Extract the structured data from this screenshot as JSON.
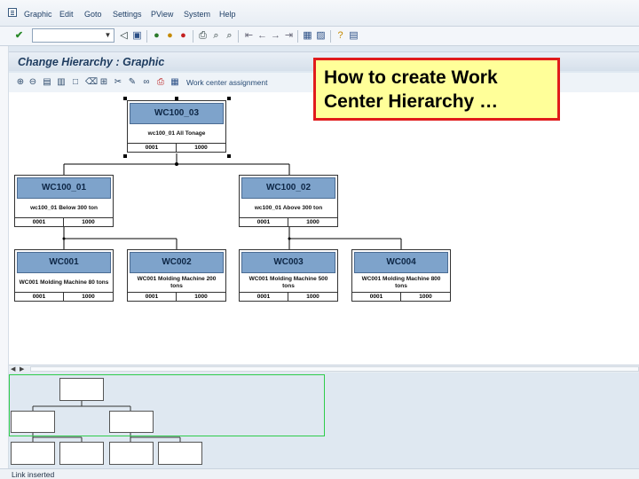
{
  "menu": {
    "items": [
      {
        "label": "Graphic"
      },
      {
        "label": "Edit"
      },
      {
        "label": "Goto"
      },
      {
        "label": "Settings"
      },
      {
        "label": "PView"
      },
      {
        "label": "System"
      },
      {
        "label": "Help"
      }
    ]
  },
  "toolbar": {
    "command_field_value": "",
    "icons": [
      "enter-icon",
      "save-icon",
      "back-icon",
      "exit-icon",
      "cancel-icon",
      "print-icon",
      "find-icon",
      "find-next-icon",
      "first-page-icon",
      "previous-page-icon",
      "next-page-icon",
      "last-page-icon",
      "create-session-icon",
      "shortcut-icon",
      "help-icon",
      "layout-icon"
    ]
  },
  "screen": {
    "title": "Change Hierarchy : Graphic",
    "work_center_assignment": "Work center assignment"
  },
  "callout": {
    "text": "How to create Work Center Hierarchy …"
  },
  "hierarchy": {
    "root": {
      "id": "WC100_03",
      "desc": "wc100_01 All Tonage",
      "plant": "0001",
      "value": "1000"
    },
    "level2": [
      {
        "id": "WC100_01",
        "desc": "wc100_01 Below 300 ton",
        "plant": "0001",
        "value": "1000"
      },
      {
        "id": "WC100_02",
        "desc": "wc100_01 Above 300 ton",
        "plant": "0001",
        "value": "1000"
      }
    ],
    "level3": [
      {
        "id": "WC001",
        "desc": "WC001 Molding Machine 80 tons",
        "plant": "0001",
        "value": "1000"
      },
      {
        "id": "WC002",
        "desc": "WC001 Molding Machine 200 tons",
        "plant": "0001",
        "value": "1000"
      },
      {
        "id": "WC003",
        "desc": "WC001 Molding Machine 500 tons",
        "plant": "0001",
        "value": "1000"
      },
      {
        "id": "WC004",
        "desc": "WC001 Molding Machine 800 tons",
        "plant": "0001",
        "value": "1000"
      }
    ]
  },
  "status": {
    "message": "Link inserted"
  },
  "colors": {
    "node_header": "#7ea3cb",
    "callout_border": "#e01b1b",
    "callout_fill": "#ffff99",
    "overview_frame": "#2ecc4b"
  }
}
